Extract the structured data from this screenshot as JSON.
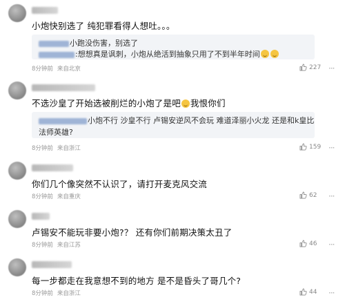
{
  "comments": [
    {
      "text": "小炮快别选了 纯犯罪看得人想吐。。。",
      "replies": [
        "小跑没伤害，别选了",
        ":想想真是讽刺，小炮从绝活到抽象只用了不到半年时间"
      ],
      "time": "8分钟前",
      "location": "来自北京",
      "likes": "227"
    },
    {
      "text": "不选沙皇了开始选被削烂的小炮了是吧",
      "text_tail": "我恨你们",
      "replies": [
        "小炮不行 沙皇不行 卢锡安逆风不会玩 难道泽丽小火龙 还是和k皇比",
        "法师英雄?"
      ],
      "time": "8分钟前",
      "location": "来自浙江",
      "likes": "159"
    },
    {
      "text": "你们几个像突然不认识了，请打开麦克风交流",
      "time": "8分钟前",
      "location": "来自重庆",
      "likes": "62"
    },
    {
      "text": "卢锡安不能玩非要小炮?？ 还有你们前期决策太丑了",
      "time": "8分钟前",
      "location": "来自江苏",
      "likes": "46"
    },
    {
      "text": "每一步都走在我意想不到的地方 是不是昏头了哥几个?",
      "time": "8分钟前",
      "location": "来自浙江",
      "likes": "44"
    }
  ],
  "icons": {
    "like": "thumbs-up-icon",
    "more": "more-dots-icon",
    "emoji": "laughing-emoji-icon"
  },
  "colors": {
    "reply_bg": "#f2f4f7",
    "meta": "#999999"
  }
}
